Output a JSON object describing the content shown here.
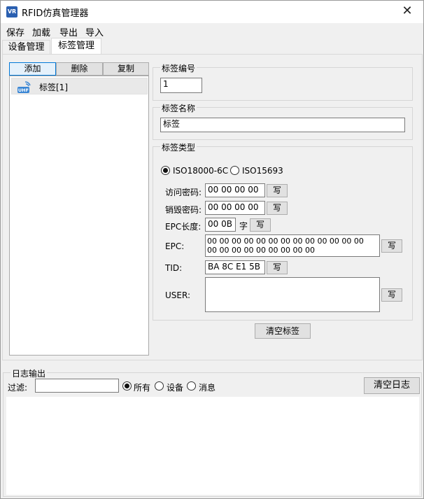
{
  "window": {
    "title": "RFID仿真管理器",
    "icon_text": "VR",
    "close_symbol": "✕"
  },
  "menu": [
    "保存",
    "加载",
    "导出",
    "导入"
  ],
  "tabs": [
    {
      "label": "设备管理",
      "active": false
    },
    {
      "label": "标签管理",
      "active": true
    }
  ],
  "tag_toolbar": {
    "add": "添加",
    "delete": "删除",
    "copy": "复制"
  },
  "tag_list": [
    {
      "icon": "uhf-tag-icon",
      "icon_text": "UHF",
      "label": "标签[1]"
    }
  ],
  "tag_number": {
    "legend": "标签编号",
    "value": "1"
  },
  "tag_name": {
    "legend": "标签名称",
    "value": "标签"
  },
  "tag_type": {
    "legend": "标签类型",
    "options": [
      {
        "label": "ISO18000-6C",
        "checked": true
      },
      {
        "label": "ISO15693",
        "checked": false
      }
    ],
    "access_password": {
      "label": "访问密码:",
      "value": "00 00 00 00",
      "write": "写"
    },
    "kill_password": {
      "label": "销毁密码:",
      "value": "00 00 00 00",
      "write": "写"
    },
    "epc_length": {
      "label": "EPC长度:",
      "value": "00 0B",
      "unit": "字",
      "write": "写"
    },
    "epc": {
      "label": "EPC:",
      "value": "00 00 00 00 00 00 00 00 00 00 00 00 00\n00 00 00 00 00 00 00 00 00",
      "write": "写"
    },
    "tid": {
      "label": "TID:",
      "value": "BA 8C E1 5B",
      "write": "写"
    },
    "user": {
      "label": "USER:",
      "value": "",
      "write": "写"
    }
  },
  "clear_tags_button": "清空标签",
  "log": {
    "legend": "日志输出",
    "filter_label": "过滤:",
    "filter_value": "",
    "filters": [
      {
        "label": "所有",
        "checked": true
      },
      {
        "label": "设备",
        "checked": false
      },
      {
        "label": "消息",
        "checked": false
      }
    ],
    "clear_button": "清空日志",
    "content": ""
  }
}
